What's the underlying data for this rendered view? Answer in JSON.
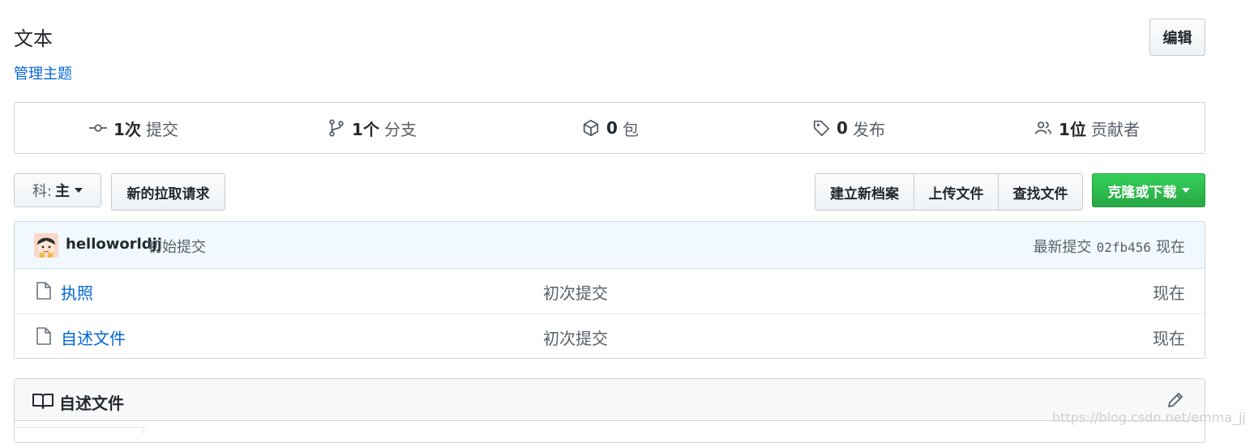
{
  "repo": {
    "description": "文本",
    "manage_topics": "管理主题",
    "edit_label": "编辑"
  },
  "summary": [
    {
      "icon": "commit-icon",
      "count": "1次",
      "label": "提交"
    },
    {
      "icon": "branch-icon",
      "count": "1个",
      "label": "分支"
    },
    {
      "icon": "package-icon",
      "count": "0",
      "label": "包"
    },
    {
      "icon": "tag-icon",
      "count": "0",
      "label": "发布"
    },
    {
      "icon": "people-icon",
      "count": "1位",
      "label": "贡献者"
    }
  ],
  "toolbar": {
    "branch_prefix": "科:",
    "branch_name": "主",
    "new_pr": "新的拉取请求",
    "create_file": "建立新档案",
    "upload_files": "上传文件",
    "find_file": "查找文件",
    "clone": "克隆或下载"
  },
  "commit": {
    "author": "helloworldjj",
    "message": "初始提交",
    "latest_label": "最新提交",
    "sha": "02fb456",
    "time": "现在"
  },
  "files": [
    {
      "name": "执照",
      "message": "初次提交",
      "age": "现在"
    },
    {
      "name": "自述文件",
      "message": "初次提交",
      "age": "现在"
    }
  ],
  "readme": {
    "title": "自述文件"
  },
  "watermark": "https://blog.csdn.net/emma_jj",
  "colors": {
    "link": "#0366d6",
    "primary": "#28a745",
    "commit_bar": "#f1f8ff"
  }
}
